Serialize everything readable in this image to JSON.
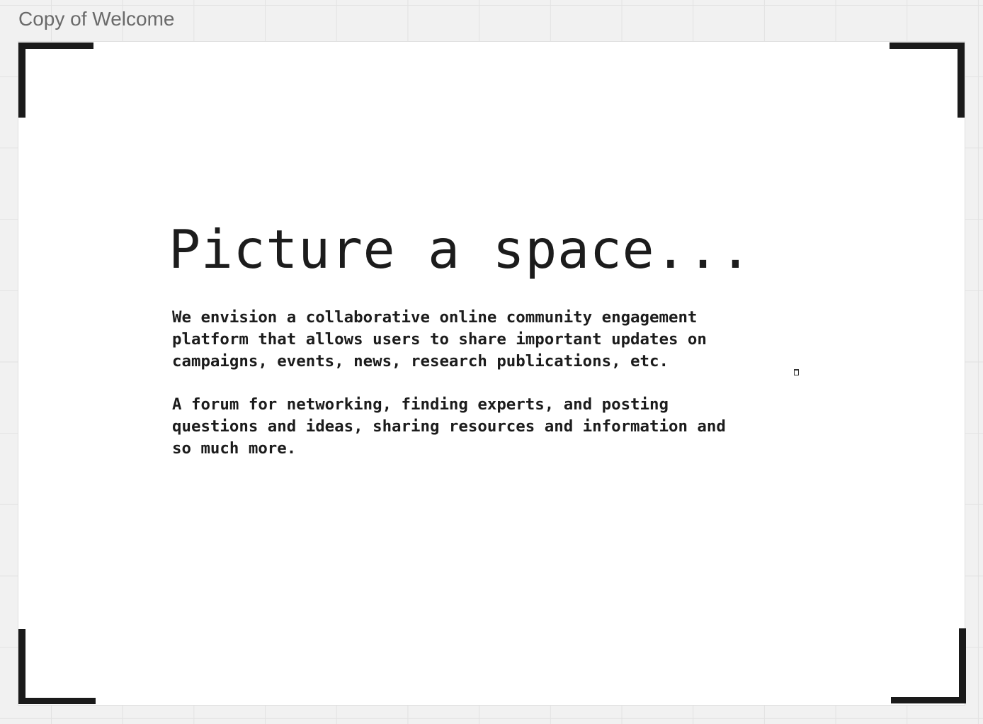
{
  "frame": {
    "title": "Copy of Welcome"
  },
  "content": {
    "headline": "Picture a space...",
    "paragraphs": [
      "We envision a collaborative online community engagement platform that allows users to share important updates on campaigns, events, news, research publications, etc.",
      "A forum for networking, finding experts, and posting questions and ideas, sharing resources and information and so much more."
    ]
  },
  "colors": {
    "canvas": "#f1f1f1",
    "grid": "#e2e2e2",
    "frame": "#ffffff",
    "ink": "#1c1c1c",
    "title": "#6a6a6a"
  }
}
